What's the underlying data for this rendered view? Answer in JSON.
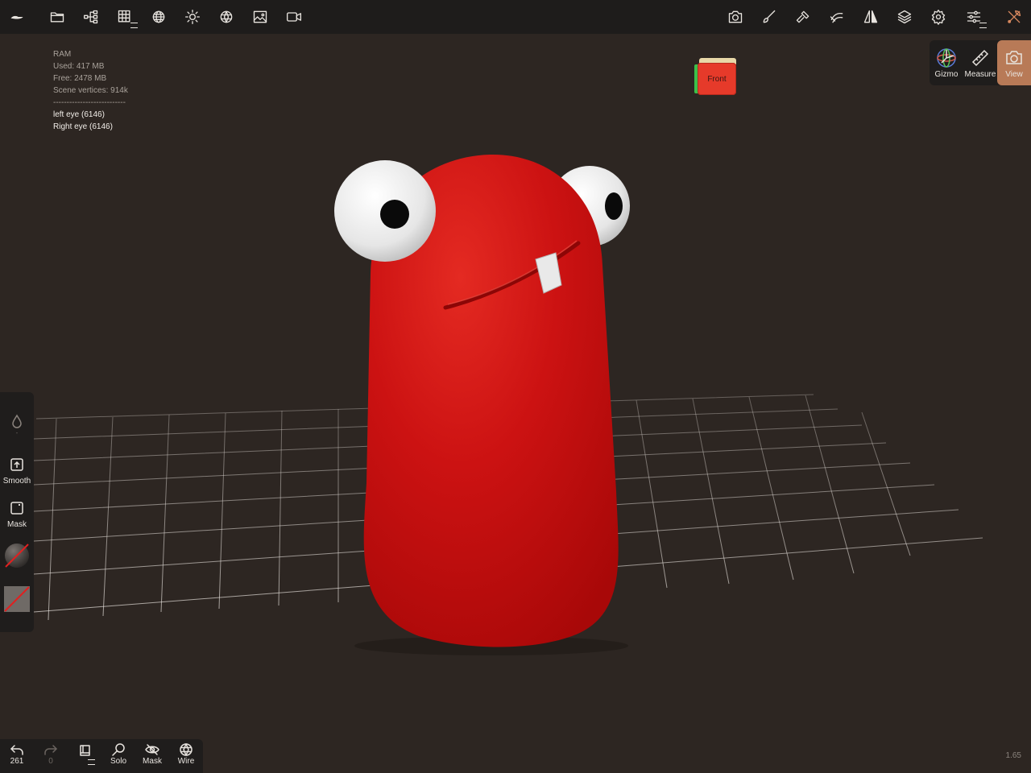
{
  "topbar": {
    "left_icons": [
      "nomad-logo-icon",
      "folder-icon",
      "scene-tree-icon",
      "grid-icon",
      "sphere-mesh-icon",
      "sun-icon",
      "shading-icon",
      "image-icon",
      "video-camera-icon"
    ],
    "right_icons": [
      "camera-icon",
      "brush-icon",
      "hammer-icon",
      "stroke-icon",
      "symmetry-icon",
      "layers-icon",
      "settings-icon",
      "sliders-icon",
      "tools-icon"
    ]
  },
  "info": {
    "ram_label": "RAM",
    "used": "Used: 417 MB",
    "free": "Free: 2478 MB",
    "vertices": "Scene vertices: 914k",
    "separator": "---------------------------",
    "selected": [
      "left eye (6146)",
      "Right eye (6146)"
    ]
  },
  "view_cube": {
    "label": "Front"
  },
  "right_panel": {
    "buttons": [
      {
        "label": "Gizmo",
        "icon": "gizmo-icon"
      },
      {
        "label": "Measure",
        "icon": "ruler-icon"
      },
      {
        "label": "View",
        "icon": "camera-icon",
        "active": true
      }
    ]
  },
  "left_panel": {
    "items": [
      {
        "label": "-",
        "icon": "drop-icon"
      },
      {
        "label": "Smooth",
        "icon": "smooth-icon"
      },
      {
        "label": "Mask",
        "icon": "mask-icon"
      }
    ]
  },
  "bottom_bar": {
    "undo_count": "261",
    "redo_count": "0",
    "solo_label": "Solo",
    "mask_label": "Mask",
    "wire_label": "Wire"
  },
  "version": "1.65",
  "colors": {
    "background": "#2d2622",
    "toolbar": "#1e1c1b",
    "accent_active": "#b87a57",
    "model_red": "#d41414"
  }
}
